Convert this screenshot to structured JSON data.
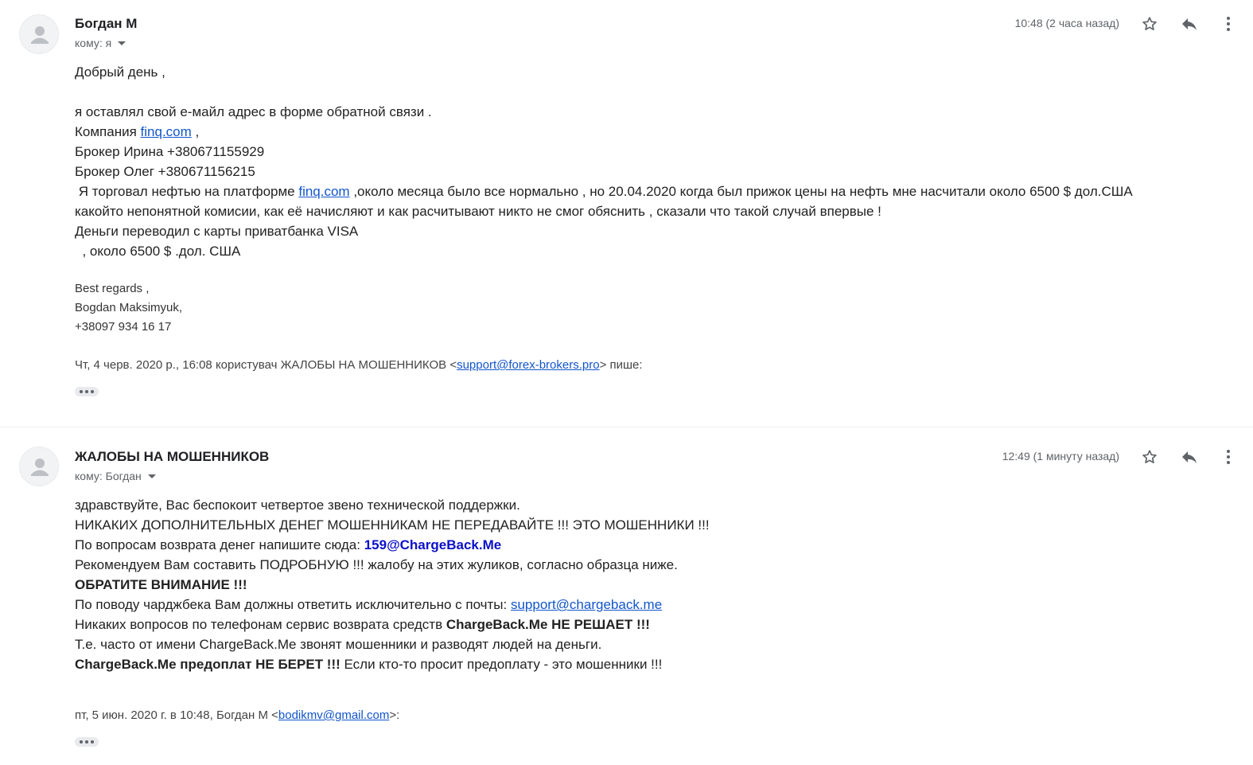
{
  "messages": [
    {
      "sender": "Богдан М",
      "recipient": "кому: я",
      "time": "10:48 (2 часа назад)",
      "body": {
        "greeting": "Добрый день ,",
        "l1": "я оставлял свой е-майл адрес в форме обратной связи .",
        "l2_pre": "Компания ",
        "l2_link": "finq.com",
        "l2_post": " ,",
        "l3": "Брокер Ирина +380671155929",
        "l4": "Брокер Олег +380671156215",
        "l5_pre": " Я торговал нефтью на платформе ",
        "l5_link": "finq.com",
        "l5_post": " ,около месяца было все нормально , но 20.04.2020 когда был прижок цены на нефть мне насчитали около 6500 $ дол.США",
        "l6": "какойто непонятной комисии, как её начисляют и как расчитывают никто не смог обяснить , сказали что такой случай впервые !",
        "l7": "Деньги переводил с карты приватбанка VISA",
        "l8": "  , около 6500 $ .дол. США"
      },
      "signature": {
        "s1": "Best regards ,",
        "s2": "Bogdan Maksimyuk,",
        "s3": "+38097 934 16 17"
      },
      "quote": {
        "pre": "Чт, 4 черв. 2020 р., 16:08 користувач ЖАЛОБЫ НА МОШЕННИКОВ <",
        "link": "support@forex-brokers.pro",
        "post": "> пише:"
      }
    },
    {
      "sender": "ЖАЛОБЫ НА МОШЕННИКОВ",
      "recipient": "кому: Богдан",
      "time": "12:49 (1 минуту назад)",
      "body": {
        "l1": "здравствуйте, Вас беспокоит четвертое звено технической поддержки.",
        "l2": "НИКАКИХ ДОПОЛНИТЕЛЬНЫХ ДЕНЕГ МОШЕННИКАМ НЕ ПЕРЕДАВАЙТЕ !!! ЭТО МОШЕННИКИ !!!",
        "l3_pre": "По вопросам возврата денег напишите сюда: ",
        "l3_bold": "159@ChargeBack.Me",
        "l4": "Рекомендуем Вам составить ПОДРОБНУЮ !!! жалобу на этих жуликов, согласно образца ниже.",
        "l5_bold": "ОБРАТИТЕ ВНИМАНИЕ !!!",
        "l6_pre": "По поводу чарджбека Вам должны ответить исключительно с почты: ",
        "l6_link": "support@chargeback.me",
        "l7_pre": "Никаких вопросов по телефонам сервис возврата средств ",
        "l7_bold": "ChargeBack.Me НЕ РЕШАЕТ !!!",
        "l8": "Т.е. часто от имени ChargeBack.Me звонят мошенники и разводят людей на деньги.",
        "l9_bold": "ChargeBack.Me предоплат НЕ БЕРЕТ !!!",
        "l9_post": " Если кто-то просит предоплату - это мошенники !!!"
      },
      "quote": {
        "pre": "пт, 5 июн. 2020 г. в 10:48, Богдан М <",
        "link": "bodikmv@gmail.com",
        "post": ">:"
      }
    }
  ],
  "icons": [
    "avatar-icon",
    "star-icon",
    "reply-icon",
    "more-vert-icon",
    "dropdown-caret-icon",
    "show-trimmed-icon"
  ],
  "colors": {
    "link": "#1155cc",
    "bold_blue": "#0b10c9",
    "muted": "#5f6368"
  }
}
